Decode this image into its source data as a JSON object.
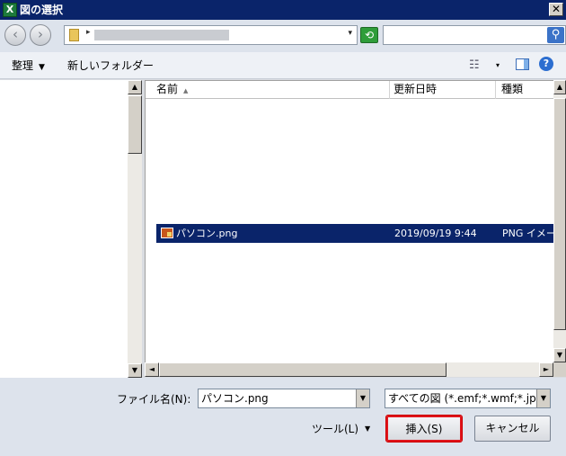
{
  "window": {
    "title": "図の選択",
    "app_icon": "X",
    "close_glyph": "✕"
  },
  "nav": {
    "back_glyph": "‹",
    "forward_glyph": "›",
    "addr_caret": "▸",
    "addr_dd": "▾",
    "refresh_glyph": "⟲",
    "search_glyph": "⚲"
  },
  "toolbar": {
    "organize": "整理",
    "organize_caret": "▼",
    "new_folder": "新しいフォルダー",
    "view_glyph": "☷",
    "view_caret": "▾",
    "help": "?"
  },
  "list": {
    "headers": {
      "name": "名前",
      "name_sort": "▲",
      "date": "更新日時",
      "type": "種類"
    },
    "rows": [
      {
        "name": "パソコン.png",
        "date": "2019/09/19 9:44",
        "type": "PNG イメージ",
        "selected": true
      }
    ]
  },
  "scroll": {
    "up": "▲",
    "down": "▼",
    "left": "◄",
    "right": "►"
  },
  "bottom": {
    "filename_label": "ファイル名(N):",
    "filename_value": "パソコン.png",
    "dd": "▼",
    "filetype_value": "すべての図 (*.emf;*.wmf;*.jpg",
    "tools": "ツール(L)",
    "tools_caret": "▼",
    "insert": "挿入(S)",
    "cancel": "キャンセル"
  },
  "colors": {
    "title_bg": "#0a246a",
    "selection_bg": "#0a246a",
    "highlight_border": "#e0151c"
  }
}
